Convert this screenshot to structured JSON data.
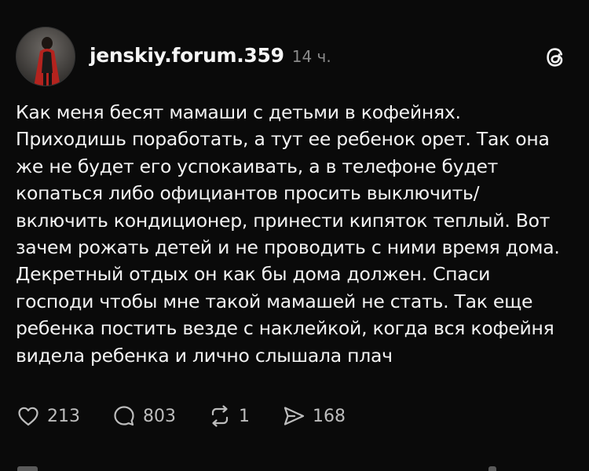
{
  "post": {
    "author": "jenskiy.forum.359",
    "time": "14 ч.",
    "avatar_icon": "profile-photo-avatar",
    "app_icon": "threads-logo-icon",
    "text_lines": [
      "Как меня бесят мамаши с детьми в кофейнях.",
      "Приходишь поработать, а тут ее ребенок орет. Так она",
      "же не будет его успокаивать, а в телефоне будет",
      "копаться либо официантов просить выключить/",
      "включить кондиционер, принести кипяток теплый. Вот",
      "зачем рожать детей и не проводить с ними время дома.",
      "Декретный отдых он как бы дома должен. Спаси",
      "господи чтобы мне такой мамашей не стать. Так еще",
      "ребенка постить везде с наклейкой, когда вся кофейня",
      "видела ребенка и лично слышала плач"
    ]
  },
  "actions": {
    "likes": "213",
    "replies": "803",
    "reposts": "1",
    "shares": "168"
  },
  "colors": {
    "background": "#0a0a0a",
    "text": "#f3f3f3",
    "muted": "#8a8a8a",
    "icon": "#bdbdbd"
  }
}
